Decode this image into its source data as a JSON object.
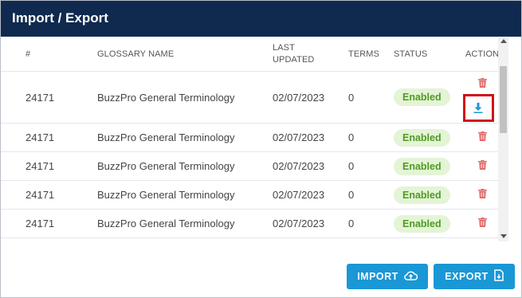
{
  "dialog": {
    "title": "Import / Export"
  },
  "table": {
    "headers": {
      "id": "#",
      "name": "GLOSSARY NAME",
      "last_updated_1": "LAST",
      "last_updated_2": "UPDATED",
      "terms": "TERMS",
      "status": "STATUS",
      "actions": "ACTIONS"
    },
    "rows": [
      {
        "id": "24171",
        "name": "BuzzPro General Terminology",
        "updated": "02/07/2023",
        "terms": "0",
        "status": "Enabled"
      },
      {
        "id": "24171",
        "name": "BuzzPro General Terminology",
        "updated": "02/07/2023",
        "terms": "0",
        "status": "Enabled"
      },
      {
        "id": "24171",
        "name": "BuzzPro General Terminology",
        "updated": "02/07/2023",
        "terms": "0",
        "status": "Enabled"
      },
      {
        "id": "24171",
        "name": "BuzzPro General Terminology",
        "updated": "02/07/2023",
        "terms": "0",
        "status": "Enabled"
      },
      {
        "id": "24171",
        "name": "BuzzPro General Terminology",
        "updated": "02/07/2023",
        "terms": "0",
        "status": "Enabled"
      }
    ]
  },
  "icons": {
    "delete": "trash-icon",
    "download": "download-icon",
    "import": "cloud-upload-icon",
    "export": "file-export-icon"
  },
  "colors": {
    "titlebar": "#0f2a4e",
    "button": "#1a97d5",
    "badge_bg": "#e4f4d6",
    "badge_text": "#4f9a24",
    "trash": "#e26a6a",
    "download": "#1a97d5",
    "highlight": "#d10f1a"
  },
  "footer": {
    "import_label": "IMPORT",
    "export_label": "EXPORT"
  }
}
